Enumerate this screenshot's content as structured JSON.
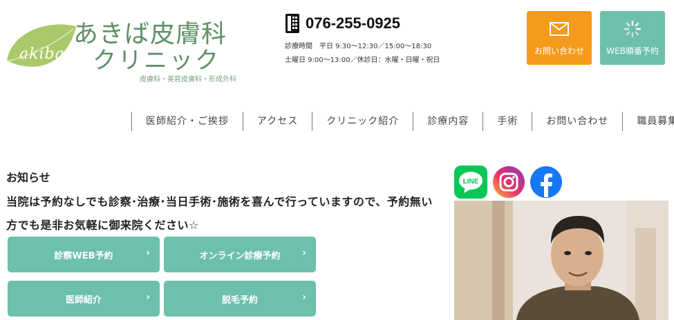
{
  "logo": {
    "leaf_text": "akiba",
    "line1": "あきば皮膚科",
    "line2": "クリニック",
    "subtitle": "皮膚科・美容皮膚科・形成外科",
    "color": "#5f8f66"
  },
  "contact": {
    "phone": "076-255-0925",
    "hours_line1": "診療時間　平日 9:30〜12:30／15:00〜18:30",
    "hours_line2": "土曜日 9:00〜13:00／休診日：水曜・日曜・祝日"
  },
  "header_buttons": {
    "contact_label": "お問い合わせ",
    "web_label": "WEB順番予約",
    "contact_color": "#f59a1a",
    "web_color": "#6cc0ad",
    "contact_icon": "mail-icon",
    "web_icon": "loading-spinner-icon"
  },
  "nav": {
    "items": [
      "医師紹介・ご挨拶",
      "アクセス",
      "クリニック紹介",
      "診療内容",
      "手術",
      "お問い合わせ",
      "職員募集"
    ]
  },
  "news": {
    "title": "お知らせ",
    "text": "当院は予約なしでも診察･治療･当日手術･施術を喜んで行っていますので、予約無い方でも是非お気軽に御来院ください☆"
  },
  "cta_buttons": [
    {
      "label": "診察WEB予約"
    },
    {
      "label": "オンライン診療予約"
    },
    {
      "label": "医師紹介"
    },
    {
      "label": "脱毛予約"
    }
  ],
  "social": {
    "line_label": "LINE",
    "icons": [
      "line-icon",
      "instagram-icon",
      "facebook-icon"
    ]
  },
  "colors": {
    "accent": "#6cc0ad",
    "orange": "#f59a1a",
    "line_green": "#06c755",
    "facebook_blue": "#1877f2"
  }
}
